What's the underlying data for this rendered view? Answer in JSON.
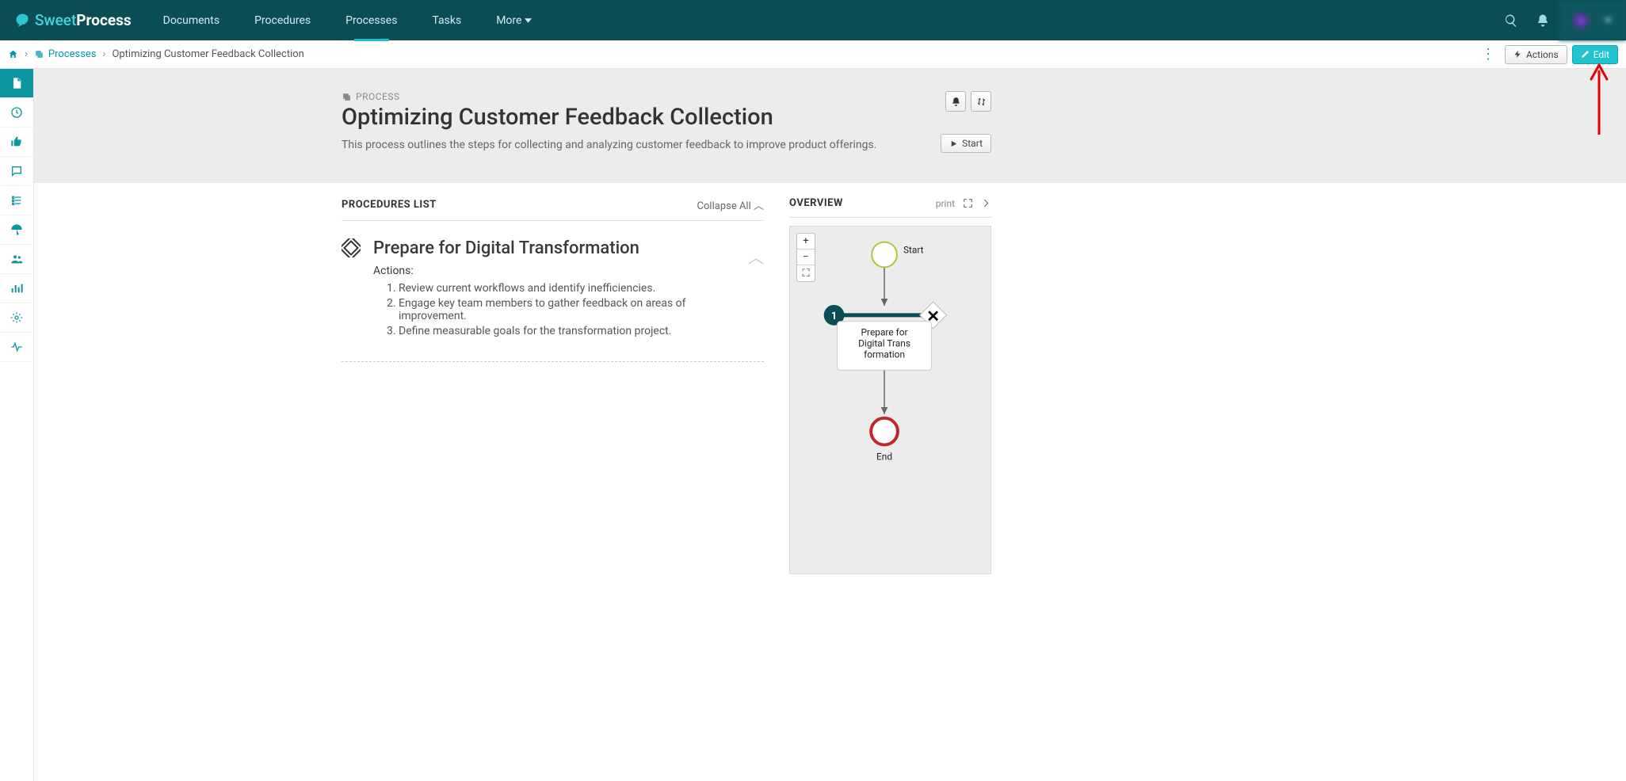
{
  "brand": {
    "sweet": "Sweet",
    "process": "Process"
  },
  "nav": {
    "documents": "Documents",
    "procedures": "Procedures",
    "processes": "Processes",
    "tasks": "Tasks",
    "more": "More"
  },
  "breadcrumb": {
    "root_link": "Processes",
    "current": "Optimizing Customer Feedback Collection"
  },
  "subbar_buttons": {
    "actions": "Actions",
    "edit": "Edit"
  },
  "header": {
    "kicker": "PROCESS",
    "title": "Optimizing Customer Feedback Collection",
    "description": "This process outlines the steps for collecting and analyzing customer feedback to improve product offerings.",
    "start": "Start"
  },
  "sections": {
    "procedures_list": "PROCEDURES LIST",
    "collapse_all": "Collapse All",
    "overview": "OVERVIEW",
    "print": "print"
  },
  "procedure": {
    "title": "Prepare for Digital Transformation",
    "actions_label": "Actions:",
    "steps": [
      "Review current workflows and identify inefficiencies.",
      "Engage key team members to gather feedback on areas of improvement.",
      "Define measurable goals for the transformation project."
    ]
  },
  "flow": {
    "start": "Start",
    "step_number": "1",
    "step_label": "Prepare for Digital Trans formation",
    "end": "End",
    "zoom_in": "+",
    "zoom_out": "−",
    "fullscreen": "⛶"
  },
  "colors": {
    "teal": "#0c969f",
    "accent": "#1fc4cf"
  }
}
